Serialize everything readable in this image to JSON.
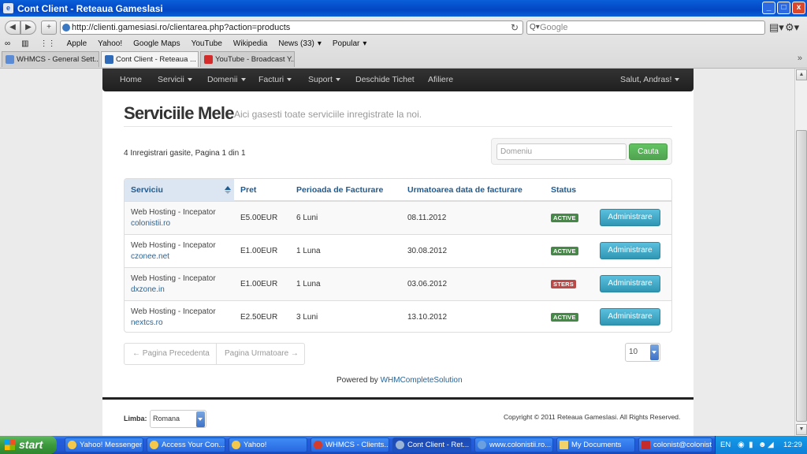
{
  "window": {
    "title": "Cont Client - Reteaua Gameslasi",
    "min": "_",
    "max": "□",
    "close": "x"
  },
  "browser": {
    "url": "http://clienti.gamesiasi.ro/clientarea.php?action=products",
    "search_placeholder": "Google",
    "bookmarks": [
      "Apple",
      "Yahoo!",
      "Google Maps",
      "YouTube",
      "Wikipedia",
      "News (33)",
      "Popular"
    ],
    "tabs": [
      {
        "label": "WHMCS - General Sett...",
        "active": false
      },
      {
        "label": "Cont Client - Reteaua ...",
        "active": true
      },
      {
        "label": "YouTube - Broadcast Y...",
        "active": false
      }
    ]
  },
  "nav": {
    "items": [
      "Home",
      "Servicii",
      "Domenii",
      "Facturi",
      "Suport",
      "Deschide Tichet",
      "Afiliere"
    ],
    "greeting": "Salut, Andras!"
  },
  "header": {
    "title": "Serviciile Mele",
    "subtitle": "Aici gasesti toate serviciile inregistrate la noi."
  },
  "listing": {
    "count_text": "4 Inregistrari gasite, Pagina 1 din 1",
    "search_placeholder": "Domeniu",
    "search_button": "Cauta"
  },
  "table": {
    "headers": [
      "Serviciu",
      "Pret",
      "Perioada de Facturare",
      "Urmatoarea data de facturare",
      "Status"
    ],
    "rows": [
      {
        "service": "Web Hosting - Incepator",
        "domain": "colonistii.ro",
        "price": "E5.00EUR",
        "period": "6 Luni",
        "next_date": "08.11.2012",
        "status": "ACTIVE",
        "action": "Administrare"
      },
      {
        "service": "Web Hosting - Incepator",
        "domain": "czonee.net",
        "price": "E1.00EUR",
        "period": "1 Luna",
        "next_date": "30.08.2012",
        "status": "ACTIVE",
        "action": "Administrare"
      },
      {
        "service": "Web Hosting - Incepator",
        "domain": "dxzone.in",
        "price": "E1.00EUR",
        "period": "1 Luna",
        "next_date": "03.06.2012",
        "status": "STERS",
        "action": "Administrare"
      },
      {
        "service": "Web Hosting - Incepator",
        "domain": "nextcs.ro",
        "price": "E2.50EUR",
        "period": "3 Luni",
        "next_date": "13.10.2012",
        "status": "ACTIVE",
        "action": "Administrare"
      }
    ]
  },
  "pagination": {
    "prev": "← Pagina Precedenta",
    "next": "Pagina Urmatoare →",
    "per_page": "10"
  },
  "powered": {
    "prefix": "Powered by",
    "link": "WHMCompleteSolution"
  },
  "footer": {
    "lang_label": "Limba:",
    "lang_value": "Romana",
    "copyright": "Copyright © 2011 Reteaua GamesIasi. All Rights Reserved."
  },
  "taskbar": {
    "start": "start",
    "tasks": [
      "Yahoo! Messenger",
      "Access Your Con...",
      "Yahoo!",
      "WHMCS - Clients...",
      "Cont Client - Ret...",
      "www.colonistii.ro...",
      "My Documents",
      "colonist@colonist..."
    ],
    "lang": "EN",
    "clock": "12:29"
  },
  "colors": {
    "status_active": "#468847",
    "status_deleted": "#b94a48",
    "admin_button": "#2f96b4",
    "search_button": "#51a351",
    "link": "#2a6496"
  }
}
